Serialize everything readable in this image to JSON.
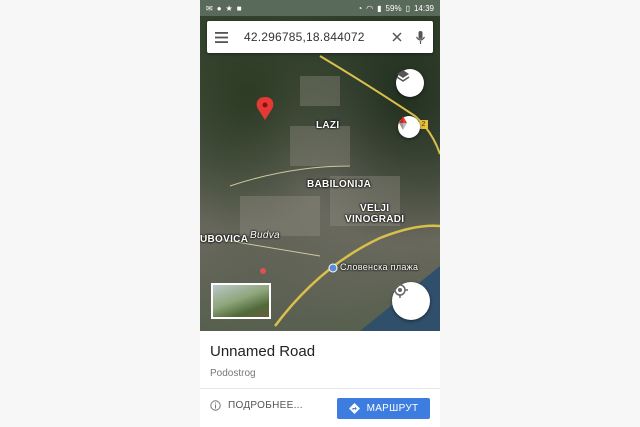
{
  "status_bar": {
    "battery": "59%",
    "time": "14:39"
  },
  "search": {
    "query": "42.296785,18.844072"
  },
  "map_labels": {
    "lazi": "LAZI",
    "babilonija": "BABILONIJA",
    "velji_vinogradi": "VELJI\nVINOGRADI",
    "dubovica": "UBOVICA",
    "budva": "Budva",
    "slovenska_plaza": "Словенска плажа",
    "road_badge": "2"
  },
  "place": {
    "title": "Unnamed Road",
    "subtitle": "Podostrog"
  },
  "actions": {
    "details_label": "ПОДРОБНЕЕ...",
    "route_label": "МАРШРУТ"
  },
  "colors": {
    "pin": "#e53935",
    "route_button": "#3d7de0",
    "road": "#d8c04a",
    "sea": "#2f4f6a"
  },
  "icons": [
    "menu-icon",
    "microphone-icon",
    "clear-icon",
    "layers-icon",
    "compass-icon",
    "my-location-icon",
    "pin-icon",
    "info-icon",
    "directions-icon"
  ]
}
